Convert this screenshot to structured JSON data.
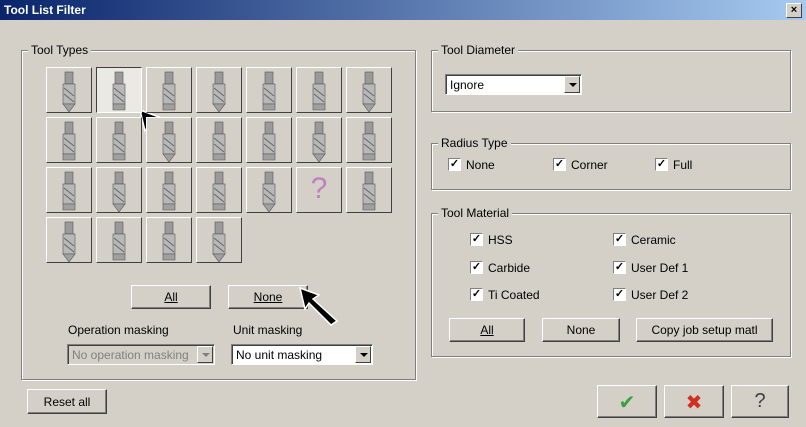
{
  "window": {
    "title": "Tool List Filter",
    "close_label": "×"
  },
  "tool_types": {
    "legend": "Tool Types",
    "tools": [
      {
        "icon": "end-mill-icon"
      },
      {
        "icon": "flat-end-mill-icon",
        "selected": true
      },
      {
        "icon": "slot-mill-icon"
      },
      {
        "icon": "face-mill-icon"
      },
      {
        "icon": "chamfer-mill-icon"
      },
      {
        "icon": "bull-nose-mill-icon"
      },
      {
        "icon": "thread-mill-icon"
      },
      {
        "icon": "spot-drill-icon"
      },
      {
        "icon": "countersink-icon"
      },
      {
        "icon": "ball-mill-icon"
      },
      {
        "icon": "tap-icon"
      },
      {
        "icon": "reamer-icon"
      },
      {
        "icon": "boring-bar-icon"
      },
      {
        "icon": "lathe-tool-icon"
      },
      {
        "icon": "lathe-insert-icon"
      },
      {
        "icon": "drill-icon"
      },
      {
        "icon": "center-drill-icon"
      },
      {
        "icon": "taper-mill-icon"
      },
      {
        "icon": "dovetail-icon"
      },
      {
        "icon": "unknown-tool-icon",
        "glyph": "?"
      },
      {
        "icon": "engrave-tool-icon"
      },
      {
        "icon": "keyseat-cutter-icon"
      },
      {
        "icon": "lollipop-mill-icon"
      },
      {
        "icon": "spring-tap-icon"
      },
      {
        "icon": "ball-end-icon"
      }
    ],
    "all_button": "All",
    "none_button": "None",
    "operation_masking_label": "Operation masking",
    "operation_masking_value": "No operation masking",
    "unit_masking_label": "Unit masking",
    "unit_masking_value": "No unit masking"
  },
  "tool_diameter": {
    "legend": "Tool Diameter",
    "value": "Ignore"
  },
  "radius_type": {
    "legend": "Radius Type",
    "options": [
      {
        "label": "None",
        "checked": true
      },
      {
        "label": "Corner",
        "checked": true
      },
      {
        "label": "Full",
        "checked": true
      }
    ]
  },
  "tool_material": {
    "legend": "Tool Material",
    "options": [
      {
        "label": "HSS",
        "checked": true
      },
      {
        "label": "Ceramic",
        "checked": true
      },
      {
        "label": "Carbide",
        "checked": true
      },
      {
        "label": "User Def 1",
        "checked": true
      },
      {
        "label": "Ti Coated",
        "checked": true
      },
      {
        "label": "User Def 2",
        "checked": true
      }
    ],
    "all_button": "All",
    "none_button": "None",
    "copy_button": "Copy job setup matl"
  },
  "footer": {
    "reset_button": "Reset all",
    "ok_glyph": "✔",
    "cancel_glyph": "✖",
    "help_glyph": "?"
  },
  "colors": {
    "title_start": "#0a246a",
    "title_end": "#a6caf0",
    "ok": "#3aa43a",
    "cancel": "#d03020"
  }
}
